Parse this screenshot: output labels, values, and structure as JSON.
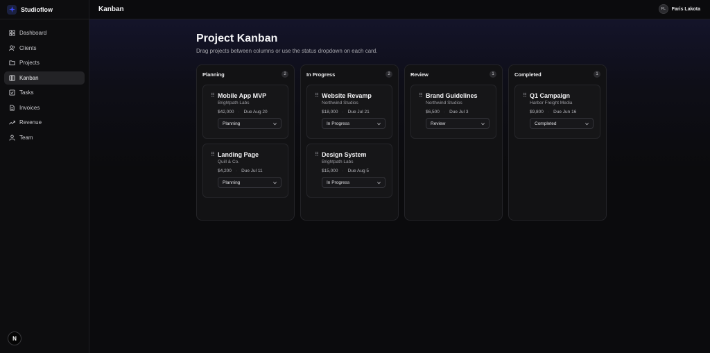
{
  "app": {
    "brand_name": "Studioflow",
    "brand_icon": "sparkle-icon",
    "brand_color": "#3b4cff"
  },
  "sidebar": {
    "items": [
      {
        "label": "Dashboard",
        "icon": "grid-icon",
        "active": false
      },
      {
        "label": "Clients",
        "icon": "users-icon",
        "active": false
      },
      {
        "label": "Projects",
        "icon": "folder-icon",
        "active": false
      },
      {
        "label": "Kanban",
        "icon": "columns-icon",
        "active": true
      },
      {
        "label": "Tasks",
        "icon": "check-square-icon",
        "active": false
      },
      {
        "label": "Invoices",
        "icon": "file-icon",
        "active": false
      },
      {
        "label": "Revenue",
        "icon": "trending-up-icon",
        "active": false
      },
      {
        "label": "Team",
        "icon": "user-icon",
        "active": false
      }
    ],
    "footer_badge": "N"
  },
  "header": {
    "title": "Kanban",
    "user_initials": "FL",
    "user_name": "Faris Lakota"
  },
  "page": {
    "title": "Project Kanban",
    "subtitle": "Drag projects between columns or use the status dropdown on each card."
  },
  "columns": [
    {
      "title": "Planning",
      "count": "2",
      "cards": [
        {
          "title": "Mobile App MVP",
          "client": "Brightpath Labs",
          "amount": "$42,000",
          "due": "Due Aug 20",
          "status": "Planning"
        },
        {
          "title": "Landing Page",
          "client": "Quill & Co.",
          "amount": "$4,200",
          "due": "Due Jul 11",
          "status": "Planning"
        }
      ]
    },
    {
      "title": "In Progress",
      "count": "2",
      "cards": [
        {
          "title": "Website Revamp",
          "client": "Northwind Studios",
          "amount": "$18,000",
          "due": "Due Jul 21",
          "status": "In Progress"
        },
        {
          "title": "Design System",
          "client": "Brightpath Labs",
          "amount": "$15,000",
          "due": "Due Aug 5",
          "status": "In Progress"
        }
      ]
    },
    {
      "title": "Review",
      "count": "1",
      "cards": [
        {
          "title": "Brand Guidelines",
          "client": "Northwind Studios",
          "amount": "$6,500",
          "due": "Due Jul 3",
          "status": "Review"
        }
      ]
    },
    {
      "title": "Completed",
      "count": "1",
      "cards": [
        {
          "title": "Q1 Campaign",
          "client": "Harbor Freight Media",
          "amount": "$9,800",
          "due": "Due Jun 16",
          "status": "Completed"
        }
      ]
    }
  ]
}
